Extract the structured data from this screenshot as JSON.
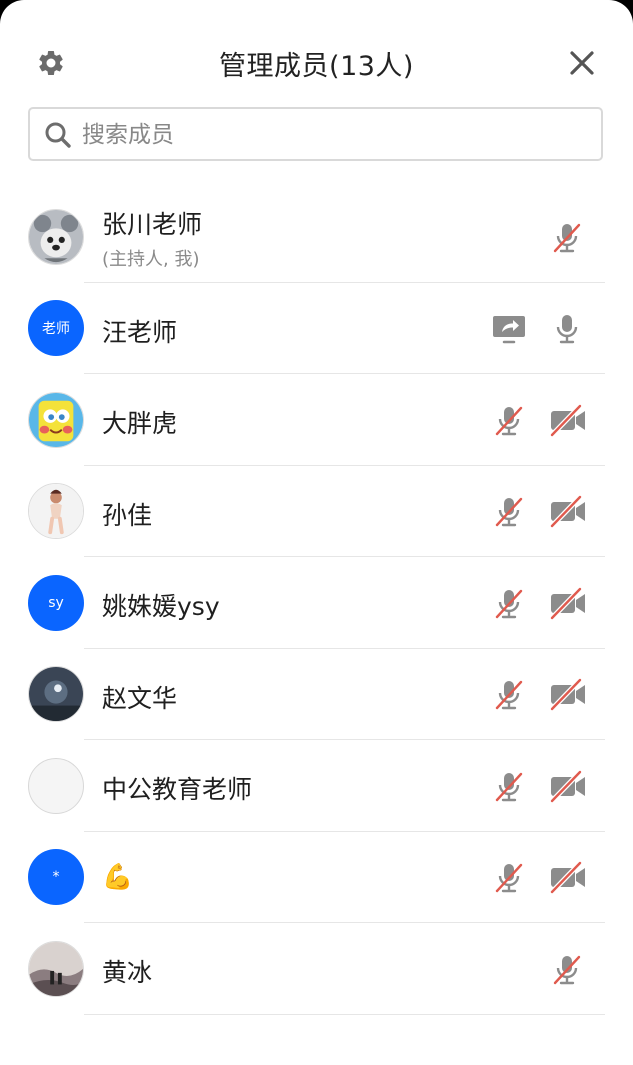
{
  "header": {
    "title": "管理成员(13人)",
    "settings_icon": "gear-icon",
    "close_icon": "close-icon"
  },
  "search": {
    "placeholder": "搜索成员"
  },
  "colors": {
    "accent": "#0a65ff",
    "muted_red": "#e05a4e",
    "icon_gray": "#8c8c8c"
  },
  "members": [
    {
      "name": "张川老师",
      "subtitle": "(主持人, 我)",
      "avatar": "dog-photo",
      "icons": [
        "mic-muted-icon"
      ]
    },
    {
      "name": "汪老师",
      "avatar_text": "老师",
      "icons": [
        "screen-share-icon",
        "mic-icon"
      ]
    },
    {
      "name": "大胖虎",
      "avatar": "sponge-photo",
      "icons": [
        "mic-muted-icon",
        "video-off-icon"
      ]
    },
    {
      "name": "孙佳",
      "avatar": "figure-photo",
      "icons": [
        "mic-muted-icon",
        "video-off-icon"
      ]
    },
    {
      "name": "姚姝媛ysy",
      "avatar_text": "sy",
      "icons": [
        "mic-muted-icon",
        "video-off-icon"
      ]
    },
    {
      "name": "赵文华",
      "avatar": "night-photo",
      "icons": [
        "mic-muted-icon",
        "video-off-icon"
      ]
    },
    {
      "name": "中公教育老师",
      "avatar": "empty",
      "icons": [
        "mic-muted-icon",
        "video-off-icon"
      ]
    },
    {
      "name": "💪",
      "avatar_text": "*",
      "icons": [
        "mic-muted-icon",
        "video-off-icon"
      ]
    },
    {
      "name": "黄冰",
      "avatar": "landscape-photo",
      "icons": [
        "mic-muted-icon"
      ]
    }
  ]
}
